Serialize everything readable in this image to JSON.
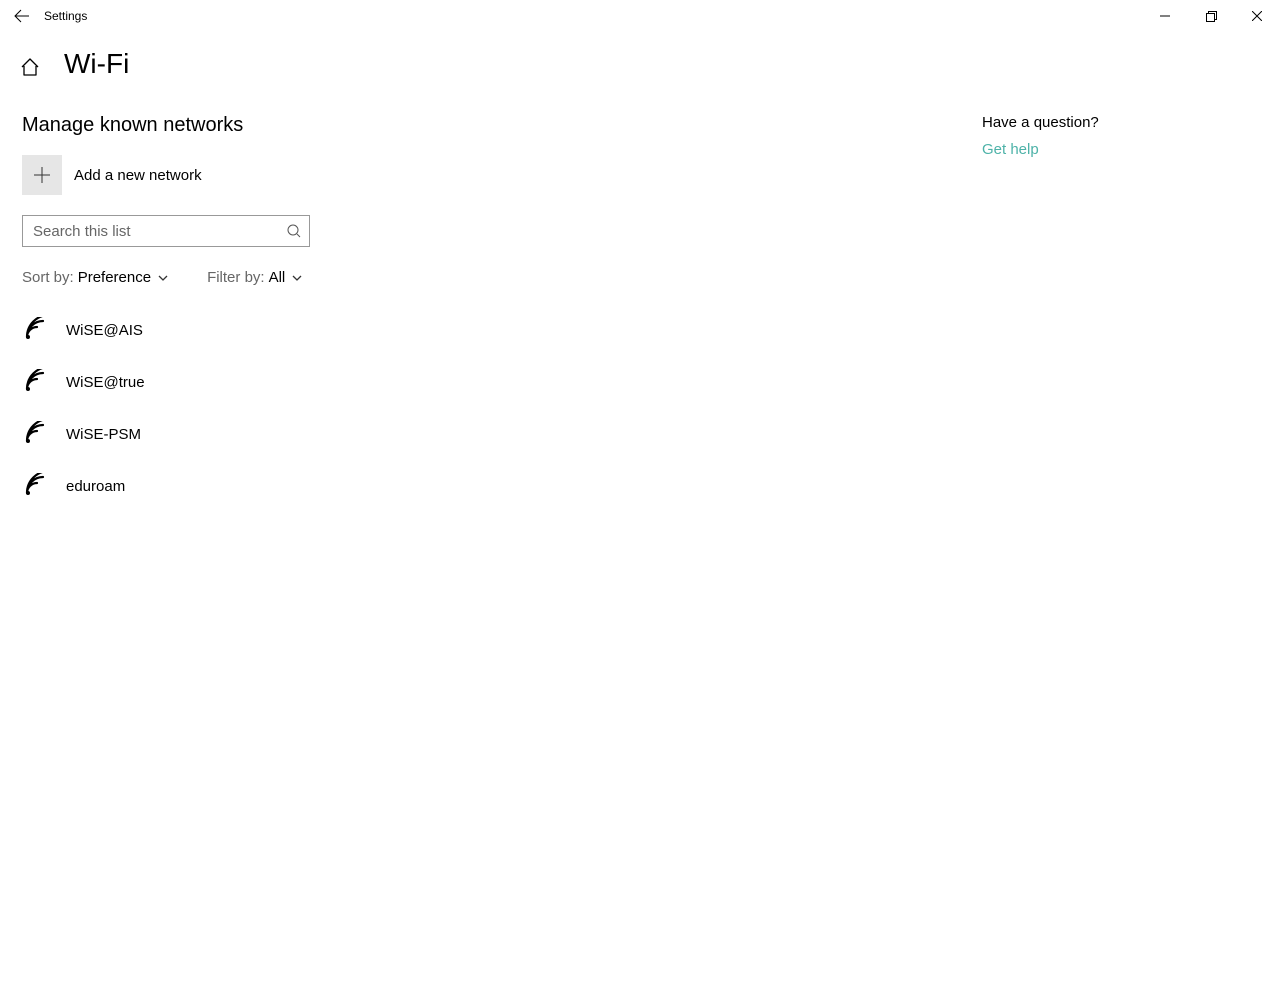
{
  "window": {
    "title": "Settings"
  },
  "header": {
    "page_title": "Wi-Fi"
  },
  "main": {
    "subtitle": "Manage known networks",
    "add_label": "Add a new network",
    "search_placeholder": "Search this list",
    "sort_label": "Sort by:",
    "sort_value": "Preference",
    "filter_label": "Filter by:",
    "filter_value": "All",
    "networks": [
      {
        "name": "WiSE@AIS"
      },
      {
        "name": "WiSE@true"
      },
      {
        "name": "WiSE-PSM"
      },
      {
        "name": "eduroam"
      }
    ]
  },
  "side": {
    "question": "Have a question?",
    "help_link": "Get help"
  }
}
